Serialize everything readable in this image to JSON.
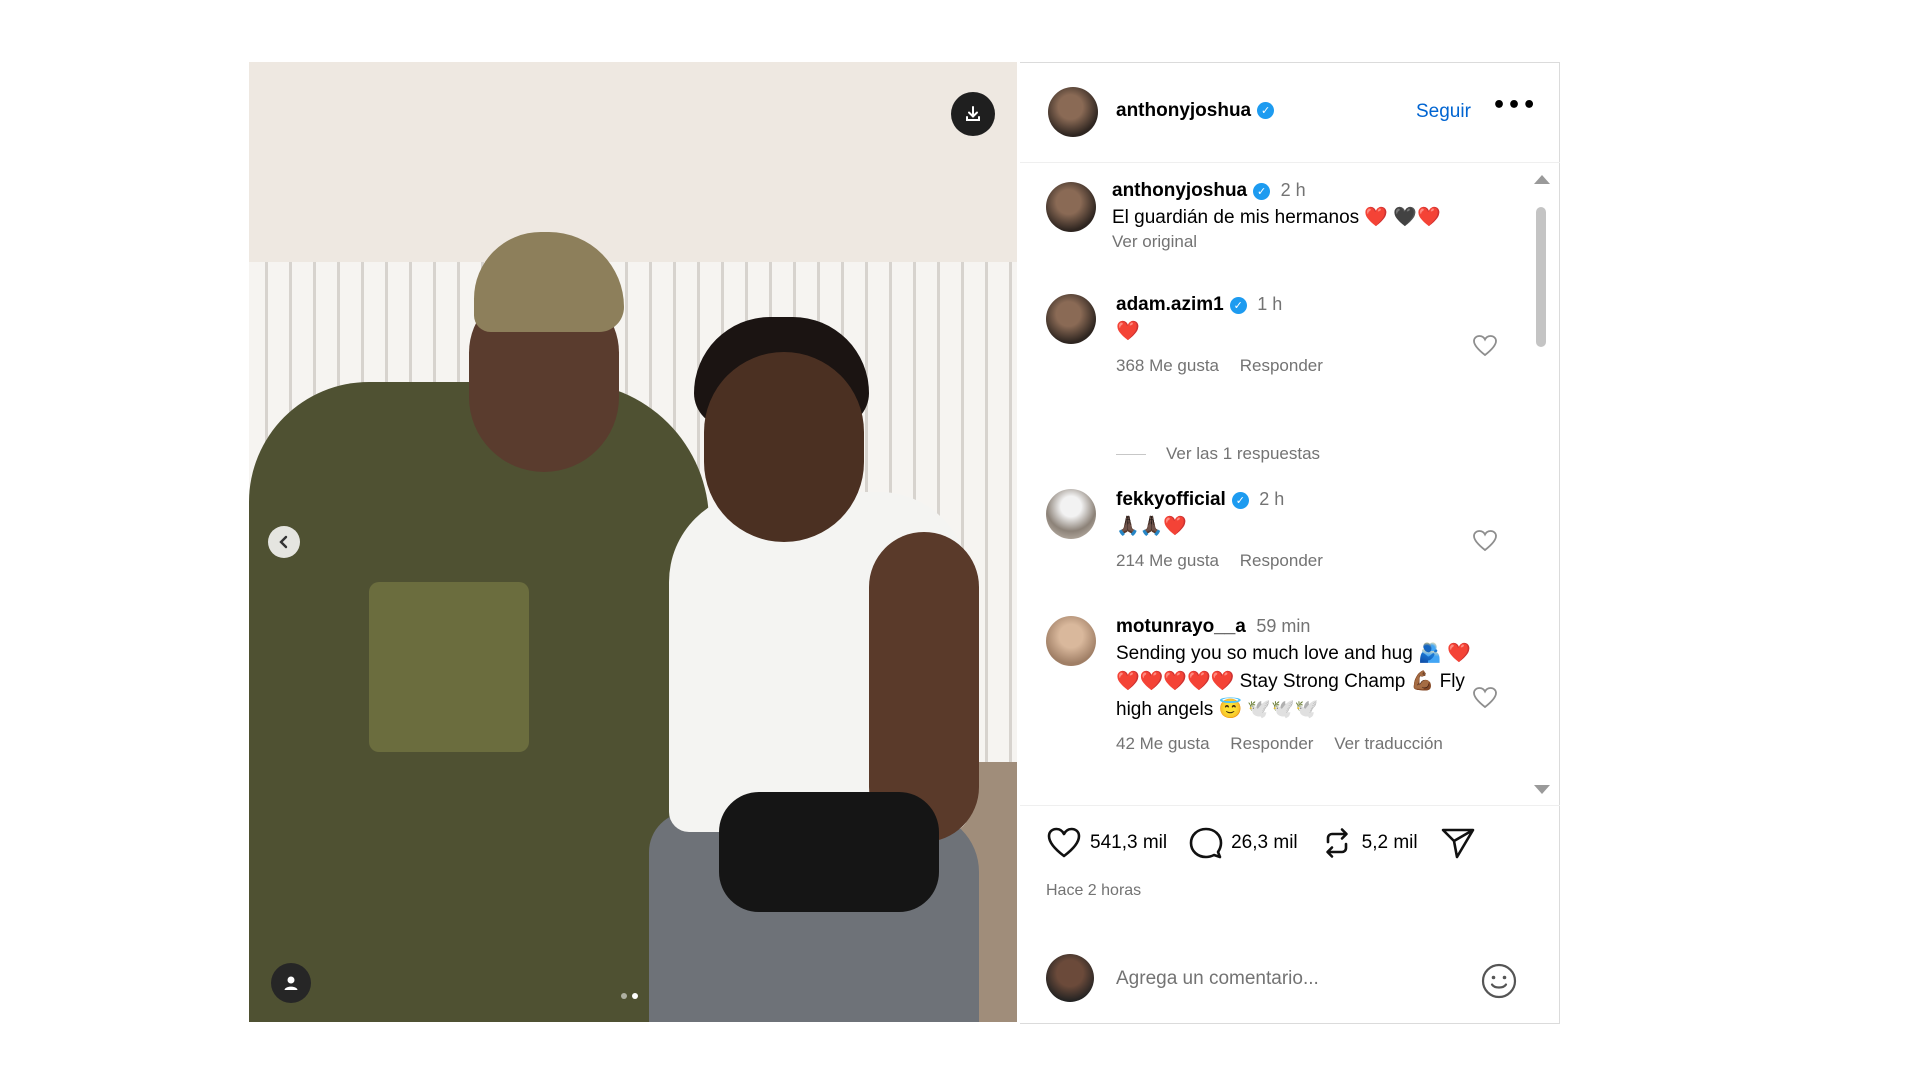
{
  "post": {
    "author": "anthonyjoshua",
    "follow_label": "Seguir",
    "more_label": "•••",
    "verified_mark": "✓"
  },
  "caption": {
    "username": "anthonyjoshua",
    "time": "2 h",
    "text": "El guardián de mis hermanos ❤️ 🖤❤️",
    "see_original": "Ver original"
  },
  "comments": [
    {
      "username": "adam.azim1",
      "time": "1 h",
      "text": "❤️",
      "likes": "368 Me gusta",
      "reply": "Responder",
      "view_replies": "Ver las 1 respuestas"
    },
    {
      "username": "fekkyofficial",
      "time": "2 h",
      "text": "🙏🏿🙏🏿❤️",
      "likes": "214 Me gusta",
      "reply": "Responder"
    },
    {
      "username": "motunrayo__a",
      "time": "59 min",
      "text": "Sending you so much love and hug 🫂 ❤️❤️❤️❤️❤️❤️ Stay Strong Champ 💪🏾 Fly high angels 😇 🕊️🕊️🕊️",
      "likes": "42 Me gusta",
      "reply": "Responder",
      "translate": "Ver traducción"
    }
  ],
  "actions": {
    "likes": "541,3 mil",
    "comments": "26,3 mil",
    "reposts": "5,2 mil",
    "timestamp": "Hace 2 horas"
  },
  "composer": {
    "placeholder": "Agrega un comentario..."
  },
  "colors": {
    "accent": "#0064d1",
    "verified": "#1d9bf0",
    "heart": "#e0201e",
    "muted": "#737373"
  },
  "carousel": {
    "slides": 2,
    "current": 2
  }
}
